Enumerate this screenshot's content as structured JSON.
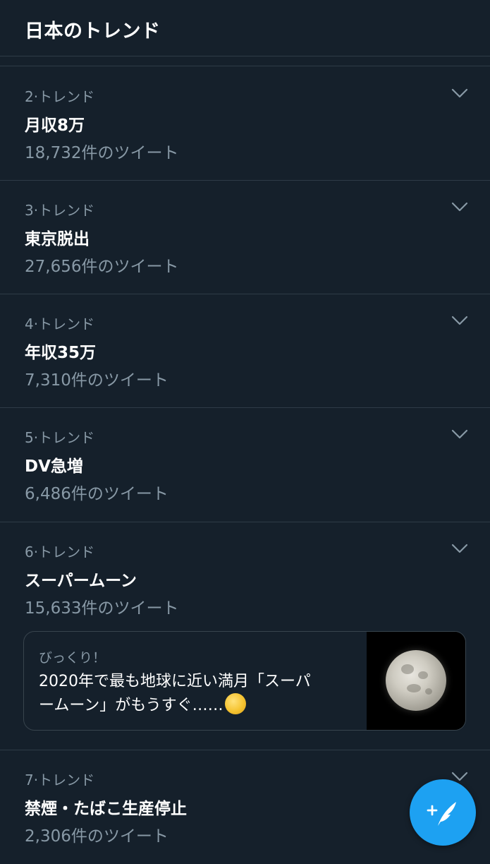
{
  "header": {
    "title": "日本のトレンド"
  },
  "trends": [
    {
      "meta": "2·トレンド",
      "name": "月収8万",
      "count": "18,732件のツイート"
    },
    {
      "meta": "3·トレンド",
      "name": "東京脱出",
      "count": "27,656件のツイート"
    },
    {
      "meta": "4·トレンド",
      "name": "年収35万",
      "count": "7,310件のツイート"
    },
    {
      "meta": "5·トレンド",
      "name": "DV急増",
      "count": "6,486件のツイート"
    },
    {
      "meta": "6·トレンド",
      "name": "スーパームーン",
      "count": "15,633件のツイート"
    },
    {
      "meta": "7·トレンド",
      "name": "禁煙・たばこ生産停止",
      "count": "2,306件のツイート"
    }
  ],
  "card": {
    "label": "びっくり！",
    "line1": "2020年で最も地球に近い満月「スーパ",
    "line2": "ームーン」がもうすぐ……"
  },
  "icons": {
    "chevron": "chevron-down-icon",
    "moon_emoji": "full-moon-emoji-icon",
    "compose": "compose-tweet-icon"
  },
  "colors": {
    "background": "#15202b",
    "secondary_text": "#8899a6",
    "divider": "#2f3b47",
    "accent": "#1da1f2"
  }
}
